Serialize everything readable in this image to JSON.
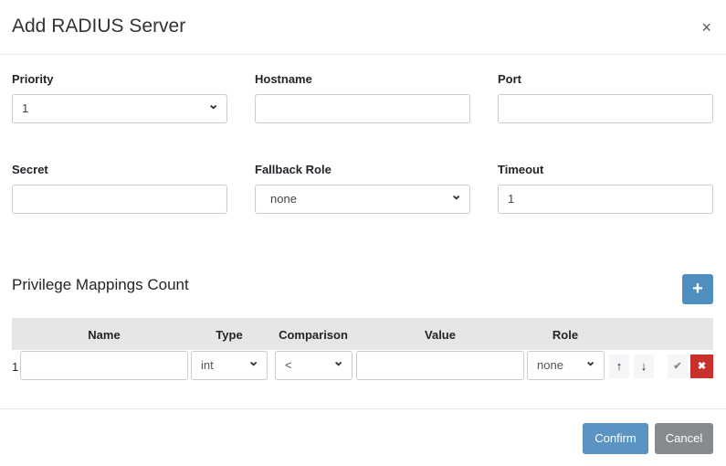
{
  "dialog": {
    "title": "Add RADIUS Server",
    "close": "×"
  },
  "fields": {
    "priority_label": "Priority",
    "priority_value": "1",
    "hostname_label": "Hostname",
    "hostname_value": "",
    "port_label": "Port",
    "port_value": "",
    "secret_label": "Secret",
    "secret_value": "",
    "fallback_label": "Fallback Role",
    "fallback_value": "none",
    "timeout_label": "Timeout",
    "timeout_value": "1"
  },
  "mappings": {
    "title": "Privilege Mappings Count",
    "add": "+",
    "headers": [
      "Name",
      "Type",
      "Comparison",
      "Value",
      "Role"
    ],
    "rows": [
      {
        "index": "1",
        "name": "",
        "type": "int",
        "comparison": "<",
        "value": "",
        "role": "none"
      }
    ],
    "up": "↑",
    "down": "↓",
    "check": "✔",
    "delete": "✖"
  },
  "footer": {
    "confirm": "Confirm",
    "cancel": "Cancel"
  }
}
